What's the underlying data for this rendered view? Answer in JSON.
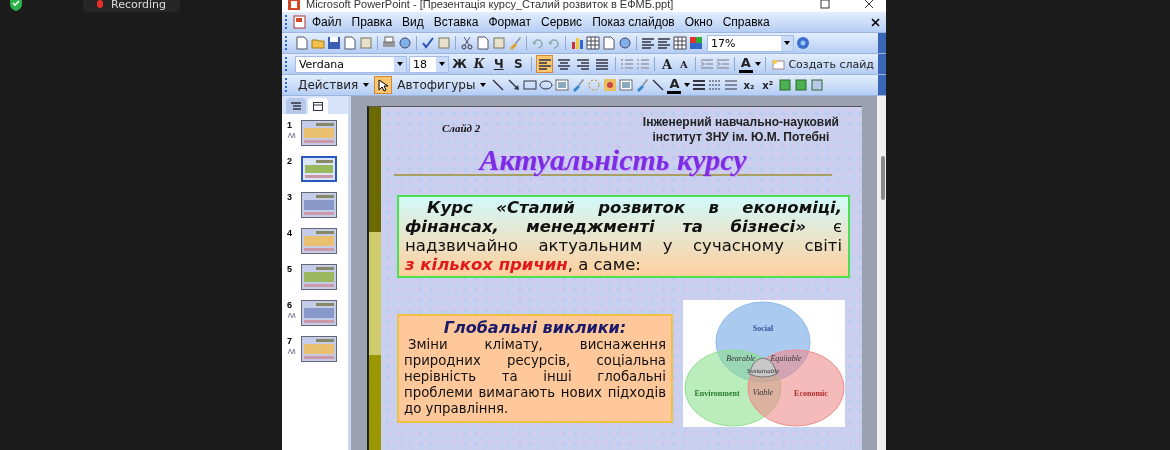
{
  "recording": {
    "label": "Recording"
  },
  "window": {
    "title": "Microsoft PowerPoint - [Презентація курсу_Сталий розвиток в ЕФМБ.ppt]"
  },
  "menu": [
    "Файл",
    "Правка",
    "Вид",
    "Вставка",
    "Формат",
    "Сервис",
    "Показ слайдов",
    "Окно",
    "Справка"
  ],
  "standard_toolbar": {
    "zoom": "17%"
  },
  "formatting_toolbar": {
    "font": "Verdana",
    "size": "18",
    "style_buttons": [
      "Ж",
      "К",
      "Ч",
      "S"
    ],
    "alignment": [
      {
        "selected": true
      },
      {
        "selected": false
      },
      {
        "selected": false
      },
      {
        "selected": false
      }
    ],
    "grow_font": "A",
    "shrink_font": "A",
    "font_color": "A",
    "new_slide": "Создать слайд"
  },
  "drawing_toolbar": {
    "actions": "Действия",
    "pointer": {
      "selected": true
    },
    "autoshapes": "Автофигуры",
    "font_color": "A",
    "subscript": "x₂",
    "superscript": "x²"
  },
  "slides_panel": {
    "tabs": [
      {
        "selected": false
      },
      {
        "selected": true
      }
    ],
    "slides": [
      {
        "number": "1",
        "selected": false,
        "animated": true
      },
      {
        "number": "2",
        "selected": true,
        "animated": false
      },
      {
        "number": "3",
        "selected": false,
        "animated": false
      },
      {
        "number": "4",
        "selected": false,
        "animated": false
      },
      {
        "number": "5",
        "selected": false,
        "animated": false
      },
      {
        "number": "6",
        "selected": false,
        "animated": true
      },
      {
        "number": "7",
        "selected": false,
        "animated": true
      }
    ]
  },
  "slide": {
    "label": "Слайд 2",
    "institute": [
      "Інженерний навчально-науковий",
      "інститут ЗНУ ім. Ю.М. Потебні"
    ],
    "title": "Актуальність курсу",
    "intro": [
      {
        "kind": "emphasis",
        "text": "Курс «Сталий розвиток в економіці, фінансах, менеджменті та бізнесі»"
      },
      {
        "kind": "plain",
        "text": " є надзвичайно актуальним у сучасному світі "
      },
      {
        "kind": "highlight",
        "text": "з кількох причин"
      },
      {
        "kind": "plain",
        "text": ", а саме:"
      }
    ],
    "challenges": {
      "heading": "Глобальні виклики:",
      "body": "Зміни клімату, виснаження природних ресурсів, соціальна нерівність та інші глобальні проблеми вимагають нових підходів до управління."
    },
    "venn": {
      "circles": [
        {
          "label": "Social",
          "color": "#8fb8ea"
        },
        {
          "label": "Environment",
          "color": "#8ee08e"
        },
        {
          "label": "Economic",
          "color": "#ee8c8c"
        }
      ],
      "overlaps": [
        "Bearable",
        "Equitable",
        "Sustainable",
        "Viable"
      ]
    }
  }
}
